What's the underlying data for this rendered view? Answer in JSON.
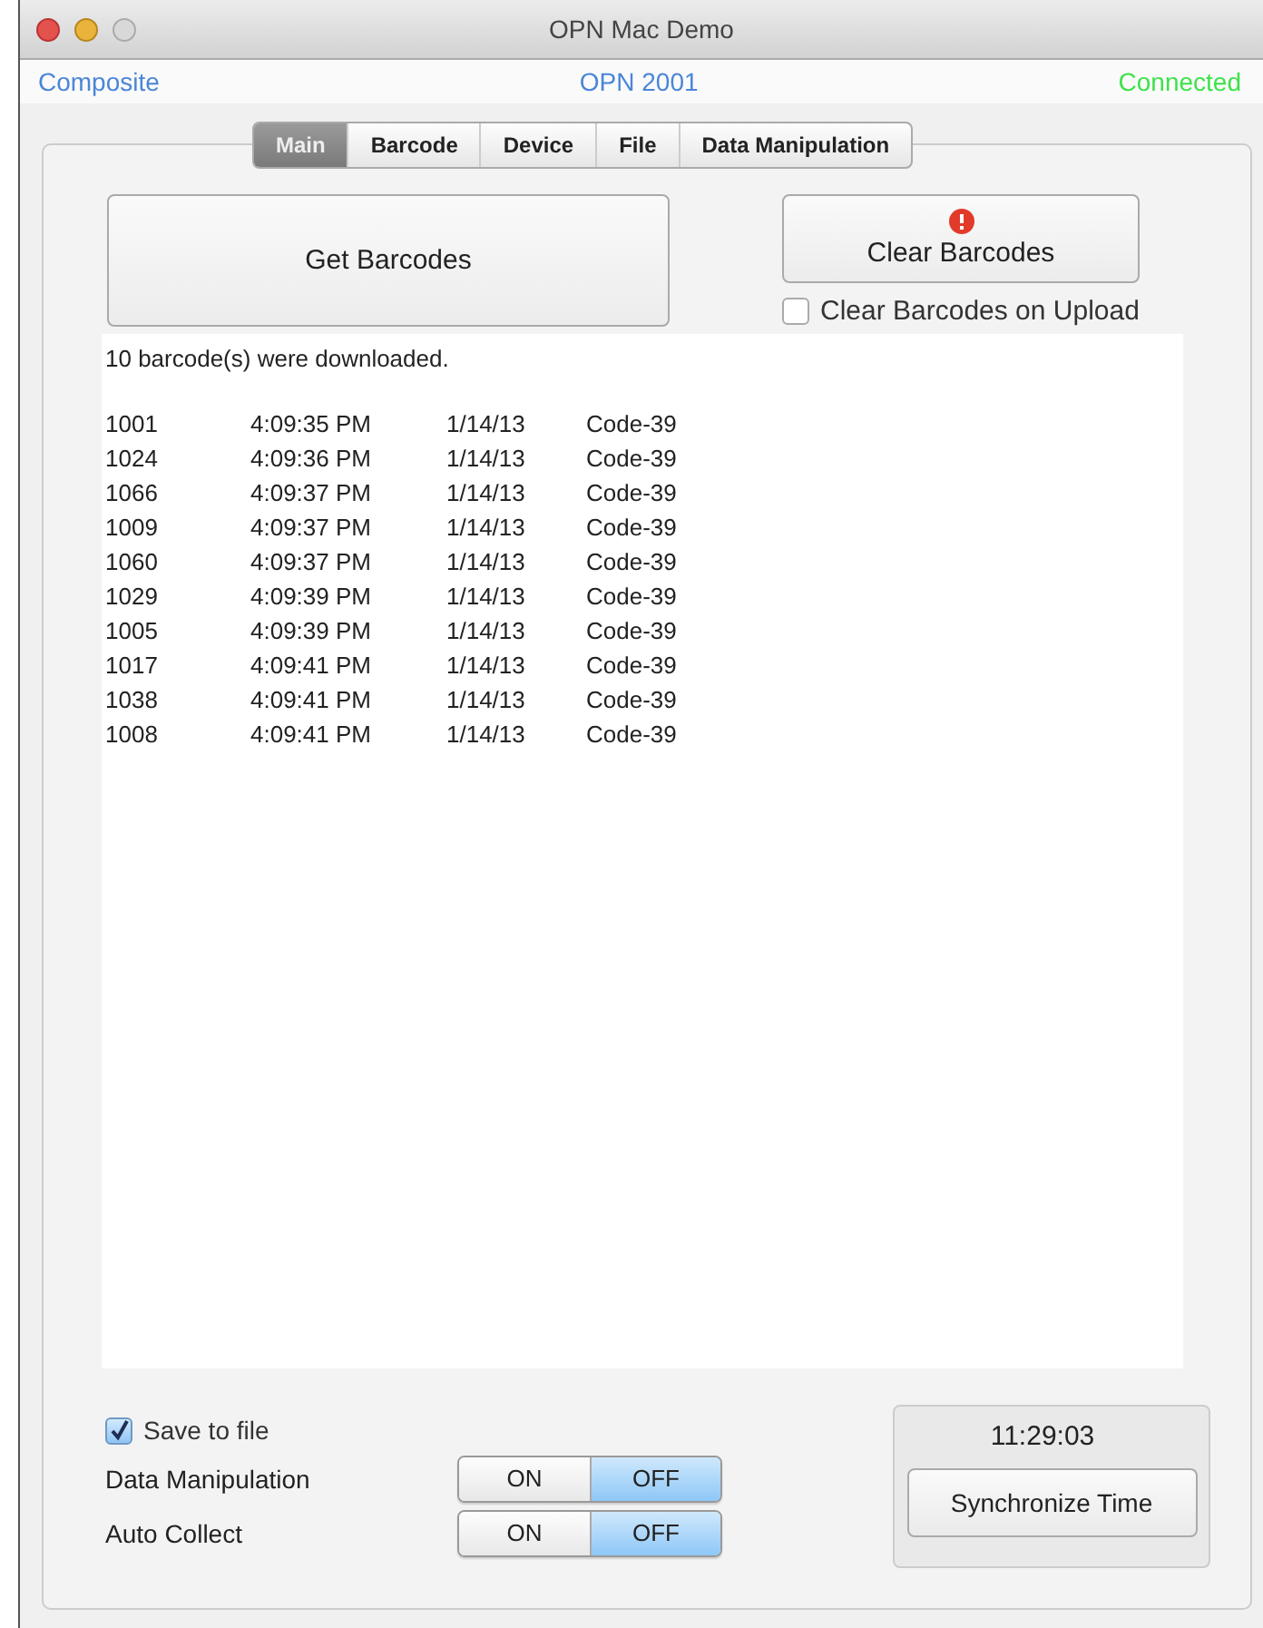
{
  "window": {
    "title": "OPN Mac Demo"
  },
  "status": {
    "mode": "Composite",
    "device": "OPN 2001",
    "connection": "Connected"
  },
  "tabs": [
    {
      "label": "Main",
      "selected": true
    },
    {
      "label": "Barcode",
      "selected": false
    },
    {
      "label": "Device",
      "selected": false
    },
    {
      "label": "File",
      "selected": false
    },
    {
      "label": "Data Manipulation",
      "selected": false
    }
  ],
  "actions": [
    {
      "label": "Get Barcodes",
      "kind": "large"
    },
    {
      "label": "Clear Barcodes",
      "kind": "alert"
    }
  ],
  "clear_on_upload": {
    "label": "Clear Barcodes on Upload",
    "checked": false
  },
  "log": {
    "summary": "10  barcode(s) were downloaded.",
    "rows": [
      {
        "code": "1001",
        "time": "4:09:35 PM",
        "date": "1/14/13",
        "symbology": "Code-39"
      },
      {
        "code": "1024",
        "time": "4:09:36 PM",
        "date": "1/14/13",
        "symbology": "Code-39"
      },
      {
        "code": "1066",
        "time": "4:09:37 PM",
        "date": "1/14/13",
        "symbology": "Code-39"
      },
      {
        "code": "1009",
        "time": "4:09:37 PM",
        "date": "1/14/13",
        "symbology": "Code-39"
      },
      {
        "code": "1060",
        "time": "4:09:37 PM",
        "date": "1/14/13",
        "symbology": "Code-39"
      },
      {
        "code": "1029",
        "time": "4:09:39 PM",
        "date": "1/14/13",
        "symbology": "Code-39"
      },
      {
        "code": "1005",
        "time": "4:09:39 PM",
        "date": "1/14/13",
        "symbology": "Code-39"
      },
      {
        "code": "1017",
        "time": "4:09:41 PM",
        "date": "1/14/13",
        "symbology": "Code-39"
      },
      {
        "code": "1038",
        "time": "4:09:41 PM",
        "date": "1/14/13",
        "symbology": "Code-39"
      },
      {
        "code": "1008",
        "time": "4:09:41 PM",
        "date": "1/14/13",
        "symbology": "Code-39"
      }
    ]
  },
  "save_to_file": {
    "label": "Save to file",
    "checked": true
  },
  "toggles": [
    {
      "label": "Data Manipulation",
      "on_label": "ON",
      "off_label": "OFF",
      "on": false
    },
    {
      "label": "Auto Collect",
      "on_label": "ON",
      "off_label": "OFF",
      "on": false
    }
  ],
  "clock": {
    "time": "11:29:03",
    "button": "Synchronize Time"
  }
}
